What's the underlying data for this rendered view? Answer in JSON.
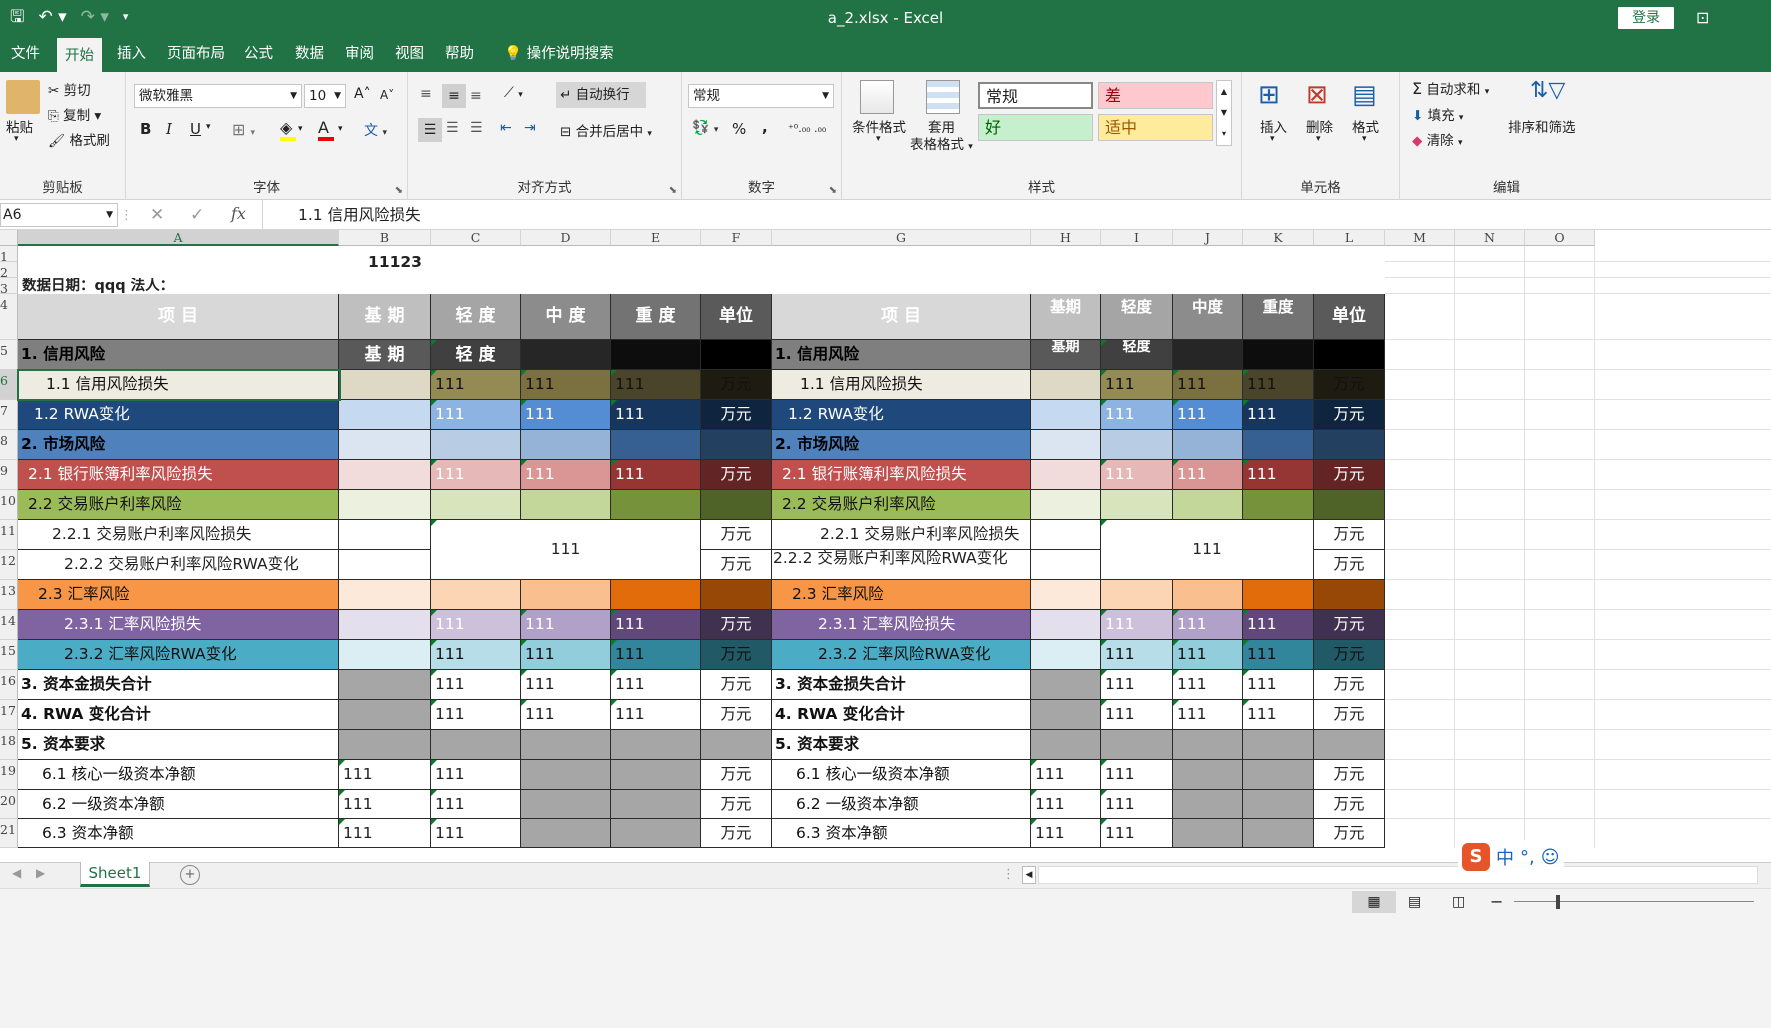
{
  "app": {
    "title": "a_2.xlsx  -  Excel",
    "login_label": "登录",
    "qat": {
      "save_icon": "save-icon",
      "undo_icon": "undo-icon",
      "redo_icon": "redo-icon"
    }
  },
  "tabs": [
    "文件",
    "开始",
    "插入",
    "页面布局",
    "公式",
    "数据",
    "审阅",
    "视图",
    "帮助",
    "操作说明搜索"
  ],
  "ribbon": {
    "clipboard": {
      "paste": "粘贴",
      "cut": "剪切",
      "copy": "复制",
      "format_painter": "格式刷",
      "label": "剪贴板"
    },
    "font": {
      "name": "微软雅黑",
      "size": "10",
      "bold": "B",
      "italic": "I",
      "underline": "U",
      "label": "字体",
      "grow": "A",
      "shrink": "A",
      "color_a": "A",
      "phonetic": "文"
    },
    "alignment": {
      "wrap": "自动换行",
      "merge": "合并后居中",
      "label": "对齐方式"
    },
    "number": {
      "format": "常规",
      "percent": "%",
      "comma": ",",
      "label": "数字"
    },
    "styles": {
      "conditional": "条件格式",
      "table1": "套用",
      "table2": "表格格式",
      "normal": "常规",
      "bad": "差",
      "good": "好",
      "neutral": "适中",
      "label": "样式"
    },
    "cells": {
      "insert": "插入",
      "delete": "删除",
      "format": "格式",
      "label": "单元格"
    },
    "editing": {
      "autosum": "自动求和",
      "fill": "填充",
      "clear": "清除",
      "sort": "排序和筛选",
      "label": "编辑"
    }
  },
  "formula_bar": {
    "name_box": "A6",
    "content": "1.1 信用风险损失",
    "fx": "fx"
  },
  "columns": [
    "A",
    "B",
    "C",
    "D",
    "E",
    "F",
    "G",
    "H",
    "I",
    "J",
    "K",
    "L",
    "M",
    "N",
    "O"
  ],
  "rows": [
    "1",
    "2",
    "3",
    "4",
    "5",
    "6",
    "7",
    "8",
    "9",
    "10",
    "11",
    "12",
    "13",
    "14",
    "15",
    "16",
    "17",
    "18",
    "19",
    "20",
    "21"
  ],
  "sheet": {
    "title_value": "11123",
    "row3": "数据日期：qqq      法人：",
    "header": {
      "item": "项          目",
      "base": "基    期",
      "light": "轻    度",
      "mid": "中    度",
      "heavy": "重    度",
      "unit": "单位"
    },
    "header_narrow": {
      "item": "项          目",
      "base": "基期",
      "light": "轻度",
      "mid": "中度",
      "heavy": "重度",
      "unit": "单位"
    },
    "row5_base": "基    期",
    "row5_light": "轻    度",
    "row5_base_narrow": "基期",
    "row5_light_narrow": "轻度",
    "val": "111",
    "unit": "万元",
    "items": {
      "r5": "1.  信用风险",
      "r6": "1.1 信用风险损失",
      "r7": "1.2 RWA变化",
      "r8": "2.  市场风险",
      "r9": "2.1 银行账簿利率风险损失",
      "r10": "2.2 交易账户利率风险",
      "r11": "2.2.1 交易账户利率风险损失",
      "r12": "2.2.2 交易账户利率风险RWA变化",
      "r13": "2.3 汇率风险",
      "r14": "2.3.1 汇率风险损失",
      "r15": "2.3.2 汇率风险RWA变化",
      "r16": "3.  资本金损失合计",
      "r17": "4.  RWA 变化合计",
      "r18": "5.  资本要求",
      "r19": "6.1 核心一级资本净额",
      "r20": "6.2 一级资本净额",
      "r21": "6.3 资本净额"
    }
  },
  "sheet_tab": "Sheet1",
  "colors": {
    "excel_green": "#217346"
  }
}
